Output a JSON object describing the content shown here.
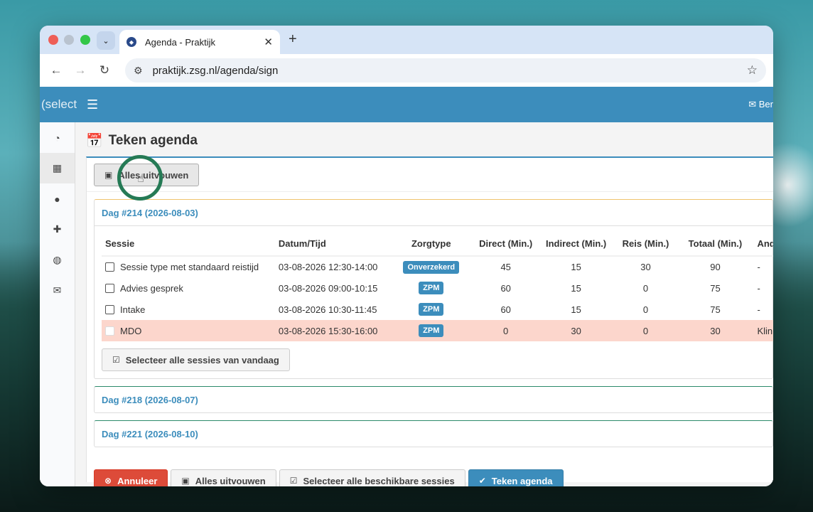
{
  "browser": {
    "tab_title": "Agenda - Praktijk",
    "url": "praktijk.zsg.nl/agenda/sign",
    "new_tab": "+",
    "tab_close": "✕"
  },
  "appbar": {
    "brand": "(select",
    "mail_label": "Ber"
  },
  "page": {
    "title": "Teken agenda"
  },
  "collapse_button": "Alles uitvouwen",
  "days": [
    {
      "title": "Dag #214 (2026-08-03)"
    },
    {
      "title": "Dag #218 (2026-08-07)"
    },
    {
      "title": "Dag #221 (2026-08-10)"
    }
  ],
  "table": {
    "headers": [
      "Sessie",
      "Datum/Tijd",
      "Zorgtype",
      "Direct (Min.)",
      "Indirect (Min.)",
      "Reis (Min.)",
      "Totaal (Min.)",
      "Ander"
    ],
    "rows": [
      {
        "sessie": "Sessie type met standaard reistijd",
        "datum": "03-08-2026 12:30-14:00",
        "zorg": "Onverzekerd",
        "direct": "45",
        "indirect": "15",
        "reis": "30",
        "totaal": "90",
        "ander": "-"
      },
      {
        "sessie": "Advies gesprek",
        "datum": "03-08-2026 09:00-10:15",
        "zorg": "ZPM",
        "direct": "60",
        "indirect": "15",
        "reis": "0",
        "totaal": "75",
        "ander": "-"
      },
      {
        "sessie": "Intake",
        "datum": "03-08-2026 10:30-11:45",
        "zorg": "ZPM",
        "direct": "60",
        "indirect": "15",
        "reis": "0",
        "totaal": "75",
        "ander": "-"
      },
      {
        "sessie": "MDO",
        "datum": "03-08-2026 15:30-16:00",
        "zorg": "ZPM",
        "direct": "0",
        "indirect": "30",
        "reis": "0",
        "totaal": "30",
        "ander": "Klinis"
      }
    ]
  },
  "select_day_button": "Selecteer alle sessies van vandaag",
  "footer": {
    "cancel": "Annuleer",
    "collapse": "Alles uitvouwen",
    "select_all": "Selecteer alle beschikbare sessies",
    "sign": "Teken agenda"
  },
  "colors": {
    "primary": "#3c8dbc",
    "danger": "#dd4b39",
    "row_danger": "#fcd6cc",
    "cursor_ring": "#257a55"
  }
}
